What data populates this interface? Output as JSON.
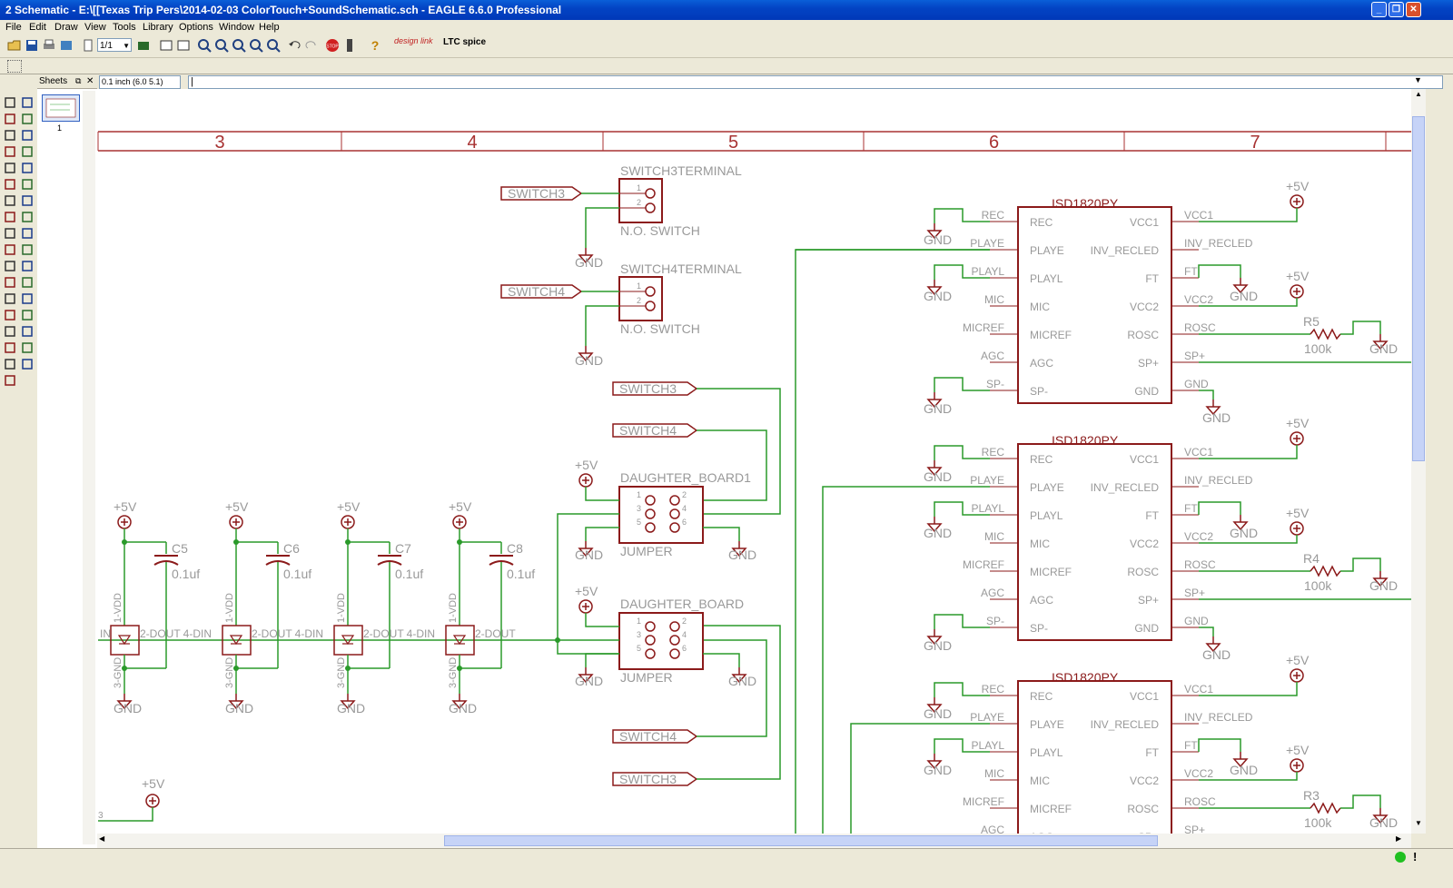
{
  "window": {
    "title": "2 Schematic - E:\\[[Texas Trip Pers\\2014-02-03 ColorTouch+SoundSchematic.sch - EAGLE 6.6.0 Professional"
  },
  "menu": [
    "File",
    "Edit",
    "Draw",
    "View",
    "Tools",
    "Library",
    "Options",
    "Window",
    "Help"
  ],
  "toolbar": {
    "sheet_select": "1/1",
    "design_link": "design link",
    "ltc_spice": "LTC spice"
  },
  "sheets_panel": {
    "title": "Sheets",
    "thumb_number": "1"
  },
  "command": {
    "grid_display": "0.1 inch (6.0 5.1)",
    "input_value": ""
  },
  "frame_columns": [
    "3",
    "4",
    "5",
    "6",
    "7"
  ],
  "schematic": {
    "switch_terminals": [
      {
        "name": "SWITCH3TERMINAL",
        "value": "N.O. SWITCH",
        "net": "SWITCH3",
        "gnd": "GND",
        "pins": [
          "1",
          "2"
        ]
      },
      {
        "name": "SWITCH4TERMINAL",
        "value": "N.O. SWITCH",
        "net": "SWITCH4",
        "gnd": "GND",
        "pins": [
          "1",
          "2"
        ]
      }
    ],
    "net_labels": [
      "SWITCH3",
      "SWITCH4",
      "SWITCH4",
      "SWITCH3"
    ],
    "jumpers": [
      {
        "name": "DAUGHTER_BOARD1",
        "value": "JUMPER",
        "supply": "+5V",
        "gnd": "GND",
        "pins": [
          "1",
          "2",
          "3",
          "4",
          "5",
          "6"
        ]
      },
      {
        "name": "DAUGHTER_BOARD",
        "value": "JUMPER",
        "supply": "+5V",
        "gnd": "GND",
        "pins": [
          "1",
          "2",
          "3",
          "4",
          "5",
          "6"
        ]
      }
    ],
    "leds": [
      {
        "cap": "C5",
        "cap_value": "0.1uf",
        "din": "IN",
        "dout": "2-DOUT",
        "vdd": "1-VDD",
        "gnd_pin": "3-GND",
        "supply": "+5V",
        "gnd": "GND"
      },
      {
        "cap": "C6",
        "cap_value": "0.1uf",
        "din": "4-DIN",
        "dout": "2-DOUT",
        "vdd": "1-VDD",
        "gnd_pin": "3-GND",
        "supply": "+5V",
        "gnd": "GND"
      },
      {
        "cap": "C7",
        "cap_value": "0.1uf",
        "din": "4-DIN",
        "dout": "2-DOUT",
        "vdd": "1-VDD",
        "gnd_pin": "3-GND",
        "supply": "+5V",
        "gnd": "GND"
      },
      {
        "cap": "C8",
        "cap_value": "0.1uf",
        "din": "4-DIN",
        "dout": "2-DOUT",
        "vdd": "1-VDD",
        "gnd_pin": "3-GND",
        "supply": "+5V",
        "gnd": "GND"
      }
    ],
    "bottom_supply": {
      "label": "+5V",
      "net": "3"
    },
    "chips": [
      {
        "name": "ISD1820PY",
        "resistor": "R5",
        "resistor_value": "100k"
      },
      {
        "name": "ISD1820PY",
        "resistor": "R4",
        "resistor_value": "100k"
      },
      {
        "name": "ISD1820PY",
        "resistor": "R3",
        "resistor_value": "100k"
      }
    ],
    "chip_pins_left": [
      "REC",
      "PLAYE",
      "PLAYL",
      "MIC",
      "MICREF",
      "AGC",
      "SP-"
    ],
    "chip_pins_right": [
      "VCC1",
      "INV_RECLED",
      "FT",
      "VCC2",
      "ROSC",
      "SP+",
      "GND"
    ],
    "chip_nets_left": [
      "REC",
      "PLAYE",
      "PLAYL",
      "MIC",
      "MICREF",
      "AGC",
      "SP-"
    ],
    "chip_nets_right": [
      "VCC1",
      "INV_RECLED",
      "FT",
      "VCC2",
      "ROSC",
      "SP+",
      "GND"
    ],
    "supply_label": "+5V",
    "gnd_label": "GND"
  },
  "colors": {
    "wire": "#2a9a2a",
    "symbol": "#8b1a1a",
    "frame": "#a83232",
    "label": "#999999",
    "title_blue": "#0a50d0"
  }
}
